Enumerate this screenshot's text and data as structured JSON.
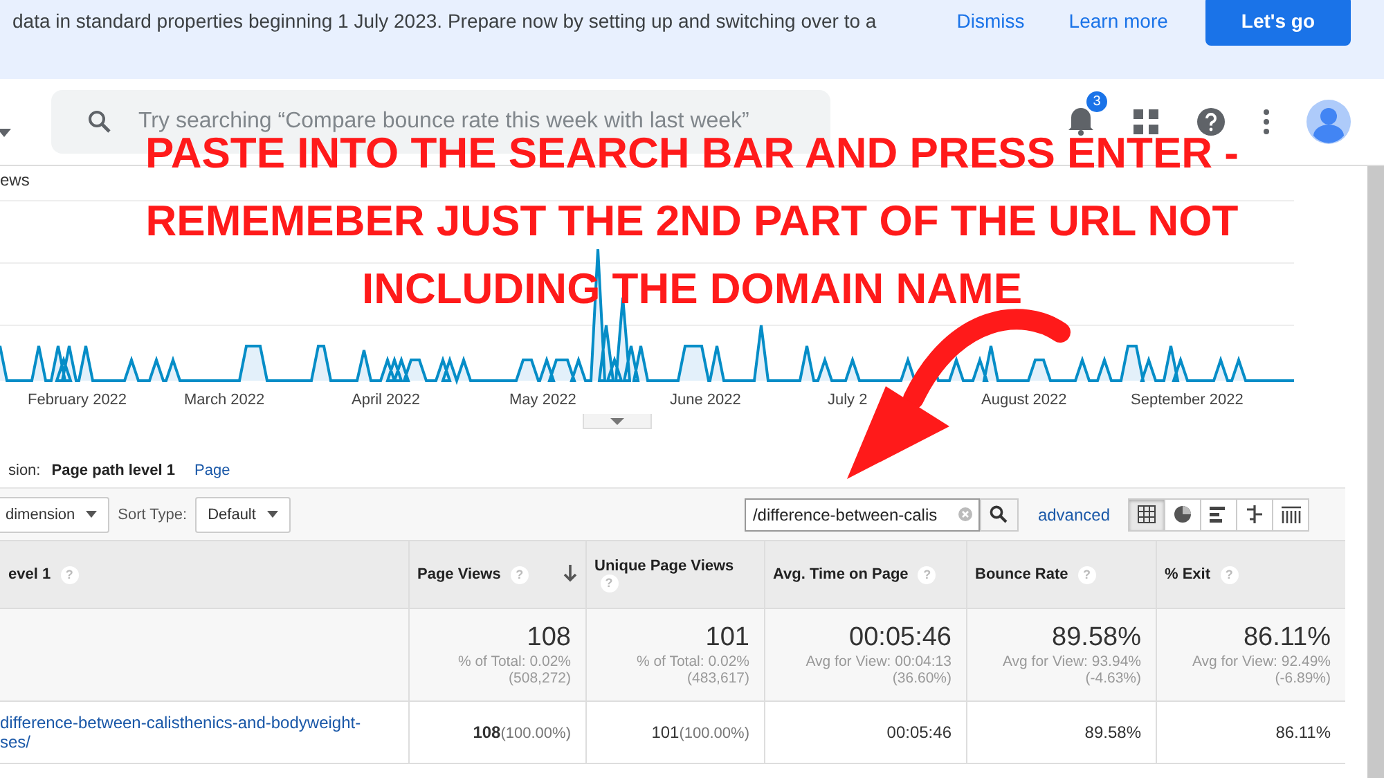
{
  "banner": {
    "text": "data in standard properties beginning 1 July 2023. Prepare now by setting up and switching over to a",
    "buttons": [
      {
        "label": "Dismiss",
        "kind": "text"
      },
      {
        "label": "Learn more",
        "kind": "text"
      },
      {
        "label": "Let's go",
        "kind": "filled"
      }
    ]
  },
  "header": {
    "search": {
      "placeholder": "Try searching “Compare bounce rate this week with last week”"
    },
    "notifications": "3"
  },
  "chart": {
    "metric_label": "ews",
    "months": [
      "February 2022",
      "March 2022",
      "April 2022",
      "May 2022",
      "June 2022",
      "July 2",
      "August 2022",
      "September 2022"
    ]
  },
  "dimension": {
    "label": "sion:",
    "options": [
      {
        "label": "Page path level 1",
        "selected": true
      },
      {
        "label": "Page",
        "selected": false
      }
    ]
  },
  "toolbar": {
    "secondary_dimension": "dimension",
    "sort_label": "Sort Type:",
    "sort_value": "Default",
    "filter": "/difference-between-calis",
    "advanced": "advanced",
    "views": [
      {
        "kind": "table",
        "selected": true
      },
      {
        "kind": "pie",
        "selected": false
      },
      {
        "kind": "bar",
        "selected": false
      },
      {
        "kind": "comparison",
        "selected": false
      },
      {
        "kind": "pivot",
        "selected": false
      }
    ]
  },
  "table": {
    "columns": [
      {
        "label": "evel 1",
        "help": "?",
        "sorted": false
      },
      {
        "label": "Page Views",
        "help": "?",
        "sorted": true
      },
      {
        "label": "Unique Page Views",
        "help": "?",
        "sorted": false
      },
      {
        "label": "Avg. Time on Page",
        "help": "?",
        "sorted": false
      },
      {
        "label": "Bounce Rate",
        "help": "?",
        "sorted": false
      },
      {
        "label": "% Exit",
        "help": "?",
        "sorted": false
      }
    ],
    "totals": [
      {
        "kind": "blank"
      },
      {
        "value": "108",
        "note": "% of Total: 0.02%",
        "base": "(508,272)"
      },
      {
        "value": "101",
        "note": "% of Total: 0.02%",
        "base": "(483,617)"
      },
      {
        "value": "00:05:46",
        "note": "Avg for View: 00:04:13",
        "base": "(36.60%)"
      },
      {
        "value": "89.58%",
        "note": "Avg for View: 93.94%",
        "base": "(-4.63%)"
      },
      {
        "value": "86.11%",
        "note": "Avg for View: 92.49%",
        "base": "(-6.89%)"
      }
    ],
    "rows": [
      {
        "cells": [
          {
            "lines": [
              "difference-between-calisthenics-and-bodyweight-",
              "ses/"
            ]
          },
          {
            "value": "108",
            "share": "(100.00%)"
          },
          {
            "value": "101",
            "share": "(100.00%)"
          },
          {
            "value": "00:05:46"
          },
          {
            "value": "89.58%"
          },
          {
            "value": "86.11%"
          }
        ]
      }
    ]
  },
  "annotation": {
    "lines": [
      "PASTE INTO THE SEARCH BAR AND PRESS ENTER -",
      "REMEMEBER JUST THE 2ND PART OF THE URL NOT",
      "INCLUDING THE DOMAIN NAME"
    ]
  }
}
